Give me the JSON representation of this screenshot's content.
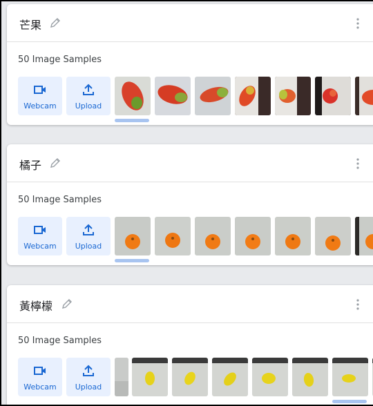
{
  "classes": [
    {
      "title": "芒果",
      "samples_label": "50 Image Samples",
      "webcam_label": "Webcam",
      "upload_label": "Upload",
      "thumbs": [
        "mango-1",
        "mango-2",
        "mango-3",
        "mango-4",
        "mango-5",
        "mango-6",
        "mango-7"
      ]
    },
    {
      "title": "橘子",
      "samples_label": "50 Image Samples",
      "webcam_label": "Webcam",
      "upload_label": "Upload",
      "thumbs": [
        "orange-1",
        "orange-2",
        "orange-3",
        "orange-4",
        "orange-5",
        "orange-6",
        "orange-7"
      ]
    },
    {
      "title": "黃檸檬",
      "samples_label": "50 Image Samples",
      "webcam_label": "Webcam",
      "upload_label": "Upload",
      "thumbs": [
        "lemon-1",
        "lemon-2",
        "lemon-3",
        "lemon-4",
        "lemon-5",
        "lemon-6",
        "lemon-7"
      ]
    }
  ],
  "icons": {
    "edit": "pencil-icon",
    "menu": "more-vert-icon",
    "webcam": "videocam-icon",
    "upload": "upload-icon"
  },
  "colors": {
    "accent": "#1967d2",
    "button_bg": "#e8f0fe",
    "scroll_indicator": "#a8c4f0"
  }
}
